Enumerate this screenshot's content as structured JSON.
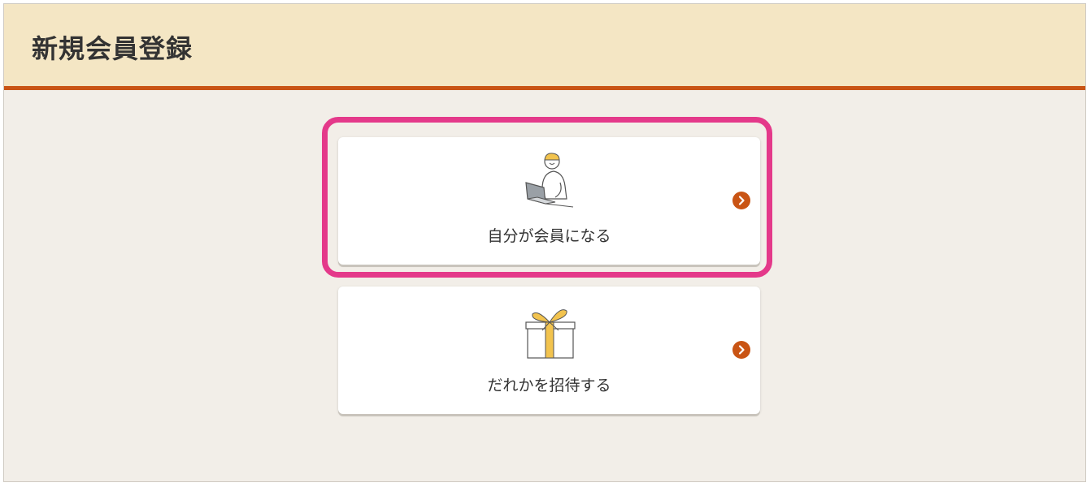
{
  "header": {
    "title": "新規会員登録"
  },
  "options": [
    {
      "label": "自分が会員になる",
      "icon": "person-laptop-icon"
    },
    {
      "label": "だれかを招待する",
      "icon": "gift-box-icon"
    }
  ],
  "colors": {
    "header_bg": "#f4e6c4",
    "accent": "#c95414",
    "highlight": "#e4398a",
    "page_bg": "#f2eee8"
  }
}
